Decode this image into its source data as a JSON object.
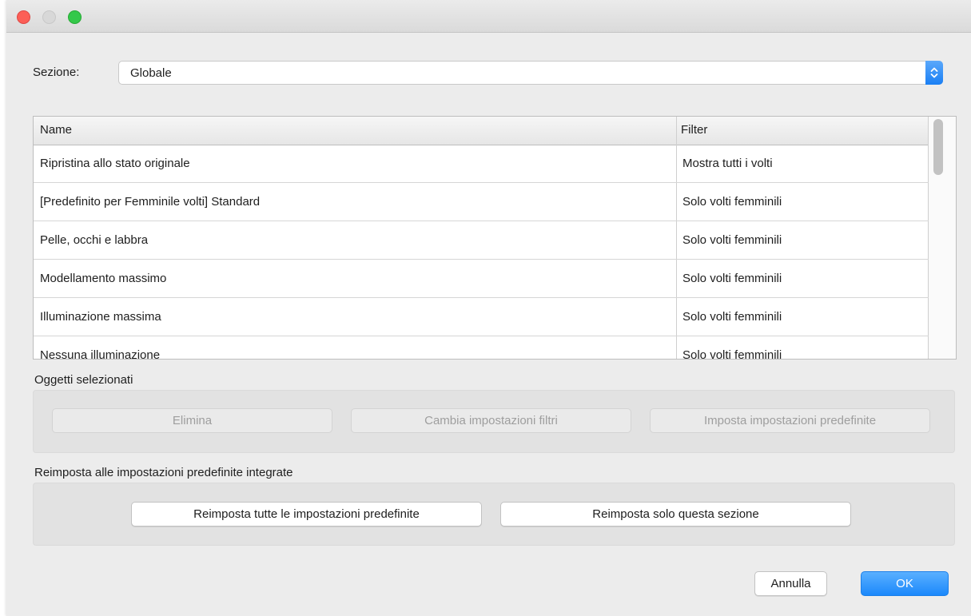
{
  "section": {
    "label": "Sezione:",
    "value": "Globale"
  },
  "table": {
    "headers": {
      "name": "Name",
      "filter": "Filter"
    },
    "rows": [
      {
        "name": "Ripristina allo stato originale",
        "filter": "Mostra tutti i volti"
      },
      {
        "name": "[Predefinito per Femminile volti] Standard",
        "filter": "Solo volti femminili"
      },
      {
        "name": "Pelle, occhi e labbra",
        "filter": "Solo volti femminili"
      },
      {
        "name": "Modellamento massimo",
        "filter": "Solo volti femminili"
      },
      {
        "name": "Illuminazione massima",
        "filter": "Solo volti femminili"
      },
      {
        "name": "Nessuna illuminazione",
        "filter": "Solo volti femminili"
      }
    ]
  },
  "selected": {
    "label": "Oggetti selezionati",
    "delete": "Elimina",
    "change_filters": "Cambia impostazioni filtri",
    "set_default": "Imposta impostazioni predefinite"
  },
  "reset": {
    "label": "Reimposta alle impostazioni predefinite integrate",
    "reset_all": "Reimposta tutte le impostazioni predefinite",
    "reset_section": "Reimposta solo questa sezione"
  },
  "footer": {
    "cancel": "Annulla",
    "ok": "OK"
  },
  "colors": {
    "accent": "#1b88fb",
    "close": "#fc5f57",
    "maximize": "#34c84a"
  }
}
